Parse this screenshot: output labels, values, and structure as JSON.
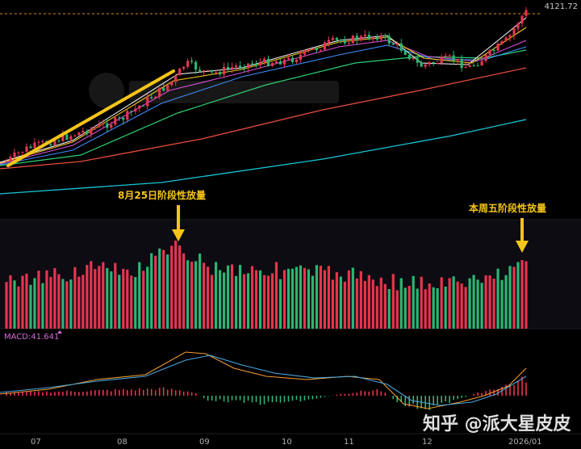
{
  "chart_data": {
    "type": "candlestick",
    "price_label": "4121.72",
    "price_range": [
      3490,
      4130
    ],
    "annotations": [
      {
        "id": "aug",
        "text": "8月25日阶段性放量"
      },
      {
        "id": "week",
        "text": "本周五阶段性放量"
      }
    ],
    "macd_label": "MACD:41.641",
    "months": [
      "07",
      "08",
      "09",
      "10",
      "11",
      "12",
      "2026/01"
    ],
    "watermark": "知乎 @派大星皮皮",
    "colors": {
      "up": "#e8344e",
      "down": "#2bb673",
      "ma5": "#ffffff",
      "ma10": "#f5c518",
      "ma20": "#d44fd6",
      "ma30": "#3d8bfd",
      "ma60": "#2ecc71",
      "ma120": "#e74c3c",
      "ma250": "#18c6d6",
      "dif": "#f39c34",
      "dea": "#4aa8e0",
      "trend": "#f5c518",
      "macd_text": "#d66bd6"
    }
  }
}
